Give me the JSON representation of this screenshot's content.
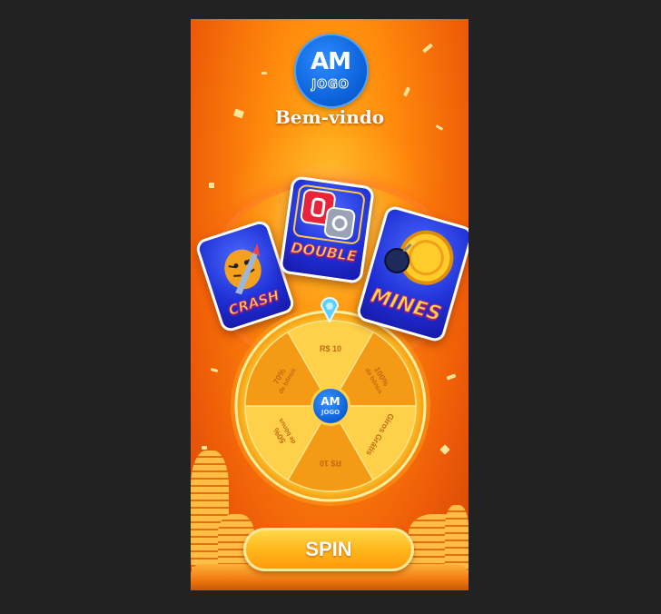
{
  "brand": {
    "logo_letters": "AM",
    "logo_sub": "JOGO",
    "welcome": "Bem-vindo"
  },
  "games": [
    {
      "label": "CRASH",
      "icon": "tiger-rocket-icon"
    },
    {
      "label": "DOUBLE",
      "icon": "double-tiles-icon"
    },
    {
      "label": "MINES",
      "icon": "coin-bomb-icon"
    }
  ],
  "wheel": {
    "segments": [
      "R$ 10",
      "100% de bônus",
      "Giros Grátis",
      "R$ 10",
      "50% de bônus",
      "70% de bônus"
    ]
  },
  "spin": {
    "label": "SPIN"
  },
  "colors": {
    "background": "#222222",
    "brand_blue": "#0a5fd6",
    "gold": "#ffd24a",
    "orange": "#ff8a0c"
  }
}
